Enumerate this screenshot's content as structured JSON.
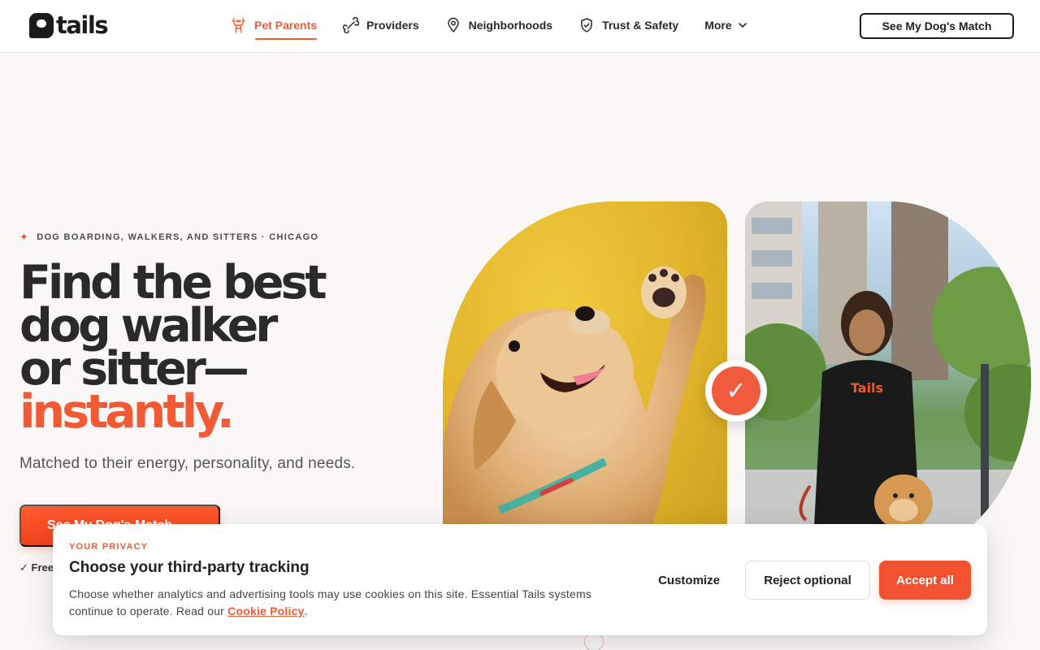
{
  "header": {
    "logo_text": "tails",
    "nav": [
      {
        "label": "Pet Parents",
        "icon": "dog-icon",
        "active": true
      },
      {
        "label": "Providers",
        "icon": "bone-icon"
      },
      {
        "label": "Neighborhoods",
        "icon": "map-pin-icon"
      },
      {
        "label": "Trust & Safety",
        "icon": "shield-check-icon"
      },
      {
        "label": "More",
        "icon": "chevron-down-icon"
      }
    ],
    "cta_label": "See My Dog's Match"
  },
  "hero": {
    "eyebrow": "DOG BOARDING, WALKERS, AND SITTERS · CHICAGO",
    "headline_1": "Find the best",
    "headline_2": "dog walker",
    "headline_3": "or sitter—",
    "headline_accent": "instantly.",
    "subhead": "Matched to their energy, personality, and needs.",
    "cta_label": "See My Dog's Match",
    "cta_arrow": "→",
    "note": "✓ Free"
  },
  "badge": {
    "check": "✓"
  },
  "cookie": {
    "kicker": "YOUR PRIVACY",
    "title": "Choose your third-party tracking",
    "body": "Choose whether analytics and advertising tools may use cookies on this site. Essential Tails systems continue to operate. Read our ",
    "link": "Cookie Policy",
    "body_end": ".",
    "customize": "Customize",
    "reject": "Reject optional",
    "accept": "Accept all"
  },
  "colors": {
    "accent": "#f05a35",
    "ink": "#2a2a2a",
    "background": "#faf8f6"
  }
}
